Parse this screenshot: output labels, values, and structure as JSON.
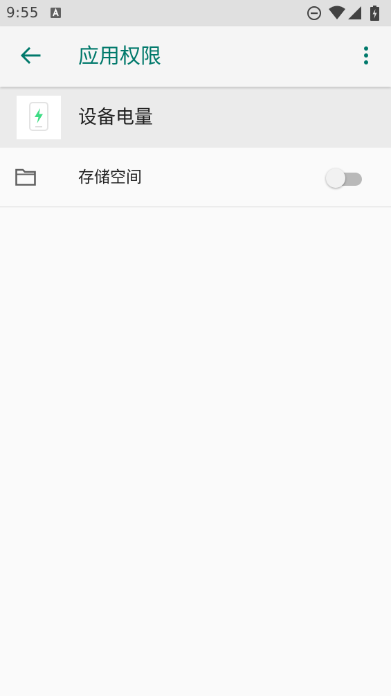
{
  "status_bar": {
    "time": "9:55",
    "icons": [
      "a-notification-icon",
      "do-not-disturb-icon",
      "wifi-icon",
      "cell-signal-icon",
      "battery-charging-icon"
    ]
  },
  "app_bar": {
    "title": "应用权限",
    "back_icon": "arrow-back-icon",
    "overflow_icon": "more-vert-icon",
    "accent": "#00796b"
  },
  "app_header": {
    "name": "设备电量",
    "icon": "battery-app-icon",
    "icon_color": "#3ddc84"
  },
  "permissions": [
    {
      "label": "存储空间",
      "icon": "folder-icon",
      "enabled": false
    }
  ]
}
